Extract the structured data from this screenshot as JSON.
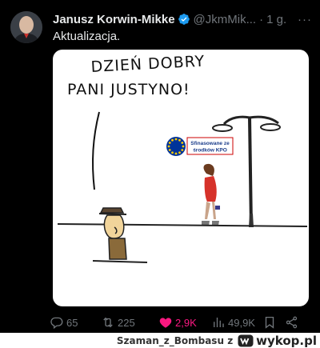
{
  "tweet": {
    "author_name": "Janusz Korwin-Mikke",
    "handle": "@JkmMik...",
    "separator": "·",
    "time": "1 g.",
    "more": "···",
    "text": "Aktualizacja."
  },
  "comic": {
    "speech_line1": "DZIEŃ DOBRY",
    "speech_line2": "PANI JUSTYNO!",
    "sign_line1": "Sfinasowane ze",
    "sign_line2": "środków KPO"
  },
  "actions": {
    "replies": "65",
    "retweets": "225",
    "likes": "2,9K",
    "views": "49,9K"
  },
  "watermark": {
    "user": "Szaman_z_Bombasu",
    "preposition": "z",
    "site": "wykop.pl"
  },
  "colors": {
    "background": "#000000",
    "text_primary": "#e7e9ea",
    "text_secondary": "#71767b",
    "like_active": "#f91880",
    "verified": "#1d9bf0",
    "eu_flag": "#003399"
  }
}
